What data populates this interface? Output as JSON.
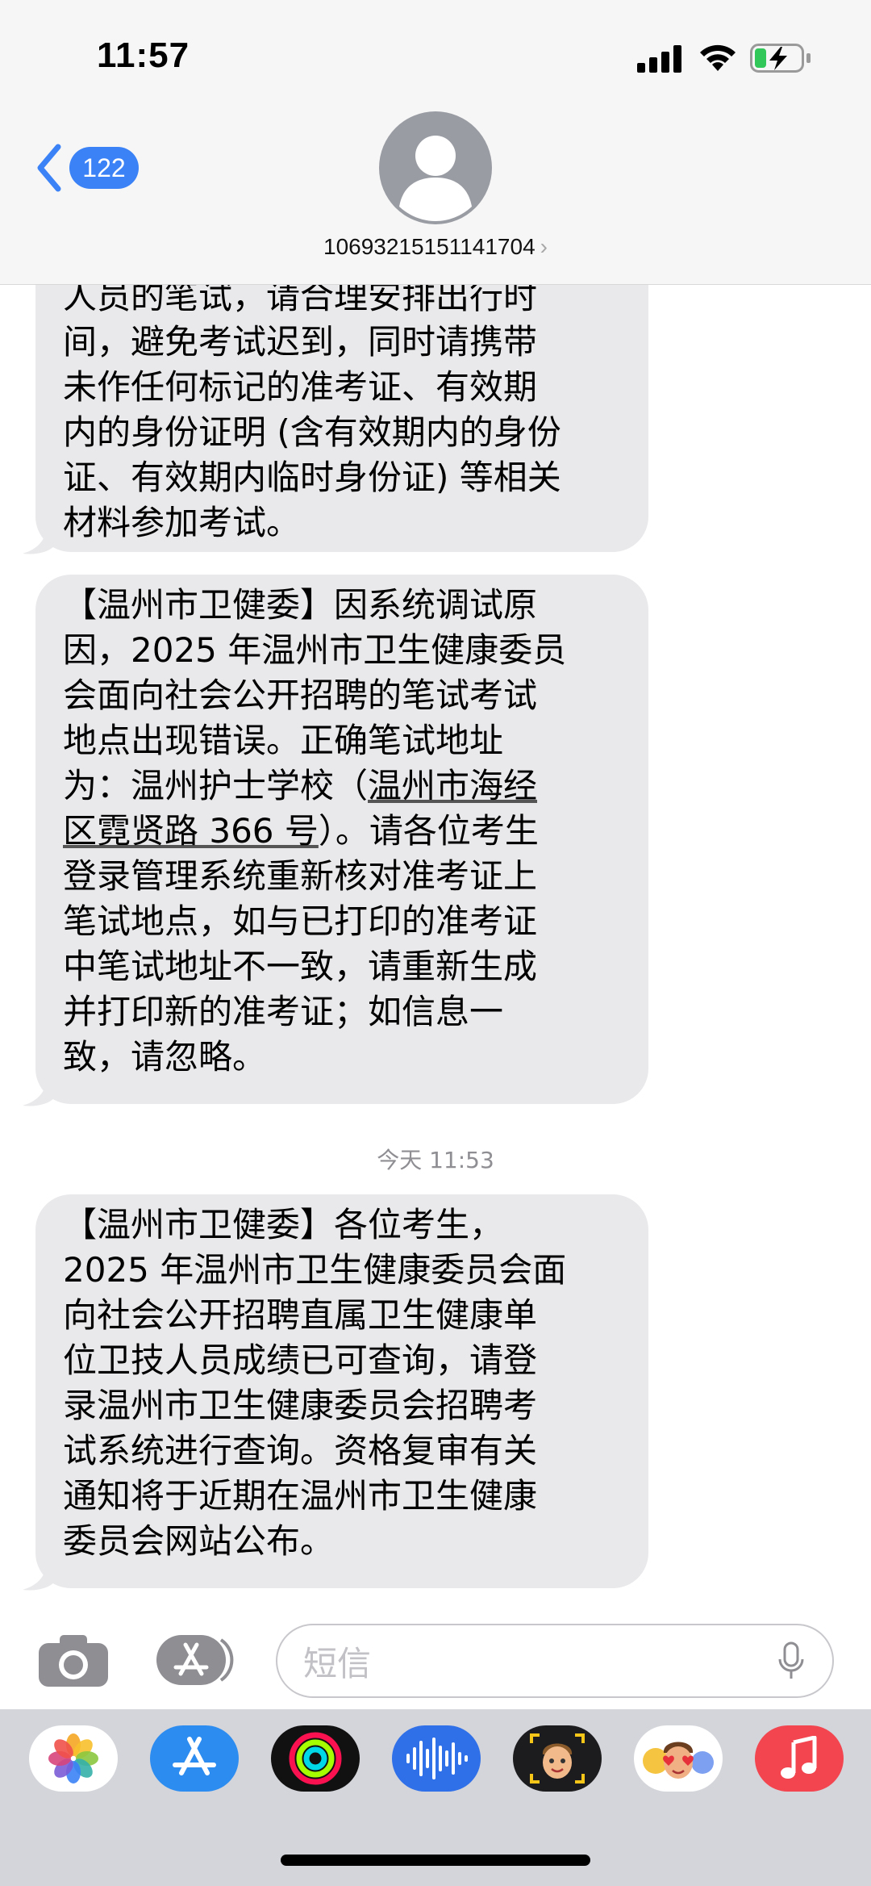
{
  "status_bar": {
    "time": "11:57"
  },
  "nav": {
    "back_count": "122",
    "contact": "10693215151141704",
    "contact_chevron": "›"
  },
  "messages": [
    {
      "lines": [
        "人员的笔试，请合理安排出行时",
        "间，避免考试迟到，同时请携带",
        "未作任何标记的准考证、有效期",
        "内的身份证明 (含有效期内的身份",
        "证、有效期内临时身份证) 等相关",
        "材料参加考试。"
      ]
    },
    {
      "lines": [
        "【温州市卫健委】因系统调试原",
        "因，2025 年温州市卫生健康委员",
        "会面向社会公开招聘的笔试考试",
        "地点出现错误。正确笔试地址",
        "为：温州护士学校（",
        "温州市海经",
        "区霓贤路 366 号",
        "）。请各位考生",
        "登录管理系统重新核对准考证上",
        "笔试地点，如与已打印的准考证",
        "中笔试地址不一致，请重新生成",
        "并打印新的准考证；如信息一",
        "致，请忽略。"
      ]
    },
    {
      "timestamp": "今天 11:53",
      "lines": [
        "【温州市卫健委】各位考生，",
        "2025 年温州市卫生健康委员会面",
        "向社会公开招聘直属卫生健康单",
        "位卫技人员成绩已可查询，请登",
        "录温州市卫生健康委员会招聘考",
        "试系统进行查询。资格复审有关",
        "通知将于近期在温州市卫生健康",
        "委员会网站公布。"
      ]
    }
  ],
  "composer": {
    "placeholder": "短信"
  },
  "icons": {
    "camera": "camera-icon",
    "apps": "app-store-icon",
    "mic": "microphone-icon"
  },
  "app_drawer": [
    "photos-icon",
    "app-store-icon",
    "fitness-icon",
    "voice-memos-icon",
    "memoji-icon",
    "animoji-stickers-icon",
    "music-icon"
  ],
  "colors": {
    "accent": "#3b82f6",
    "bubble": "#e9e9eb",
    "music": "#f2454f"
  }
}
